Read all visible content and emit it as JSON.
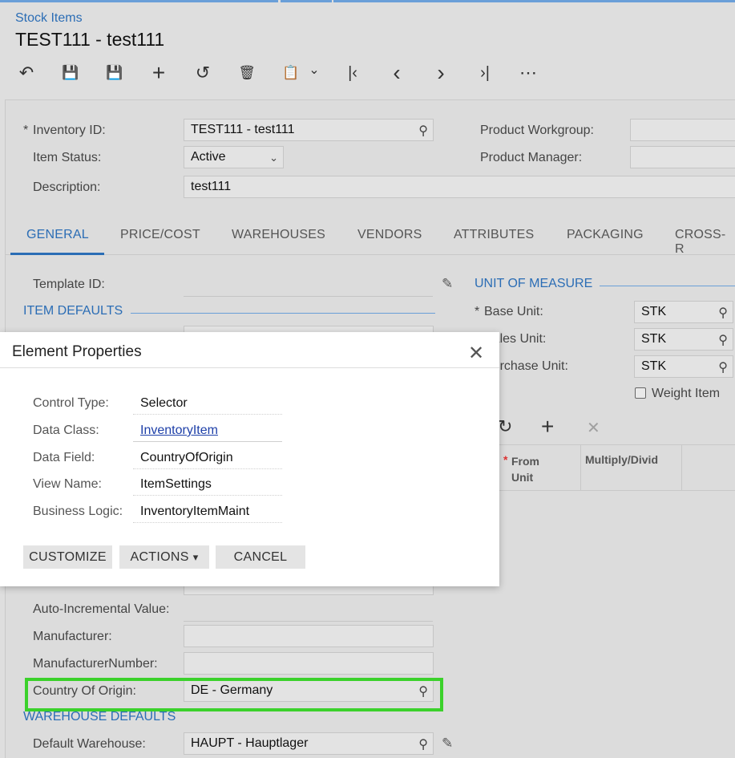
{
  "breadcrumb": "Stock Items",
  "page_title": "TEST111 - test111",
  "toolbar": {
    "back": "↶",
    "save_close": "💾",
    "save": "💾",
    "add": "+",
    "undo": "↺",
    "delete": "🗑",
    "clipboard": "📋",
    "clipboard_caret": "⌄",
    "first": "|‹",
    "prev": "‹",
    "next": "›",
    "last": "›|",
    "more": "⋯"
  },
  "summary": {
    "inventory_id_label": "Inventory ID:",
    "inventory_id_value": "TEST111 - test111",
    "item_status_label": "Item Status:",
    "item_status_value": "Active",
    "description_label": "Description:",
    "description_value": "test111",
    "product_workgroup_label": "Product Workgroup:",
    "product_manager_label": "Product Manager:"
  },
  "tabs": [
    "GENERAL",
    "PRICE/COST",
    "WAREHOUSES",
    "VENDORS",
    "ATTRIBUTES",
    "PACKAGING",
    "CROSS-R"
  ],
  "general": {
    "template_id_label": "Template ID:",
    "item_defaults_title": "ITEM DEFAULTS",
    "auto_incremental_label": "Auto-Incremental Value:",
    "manufacturer_label": "Manufacturer:",
    "manufacturer_number_label": "ManufacturerNumber:",
    "country_label": "Country Of Origin:",
    "country_value": "DE - Germany",
    "warehouse_defaults_title": "WAREHOUSE DEFAULTS",
    "default_warehouse_label": "Default Warehouse:",
    "default_warehouse_value": "HAUPT - Hauptlager"
  },
  "uom": {
    "title": "UNIT OF MEASURE",
    "base_unit_label": "Base Unit:",
    "base_unit_value": "STK",
    "sales_unit_label": "Sales Unit:",
    "sales_unit_value": "STK",
    "purchase_unit_label": "Purchase Unit:",
    "purchase_unit_value": "STK",
    "weight_item_label": "Weight Item",
    "grid_from_unit": "From Unit",
    "grid_multiply": "Multiply/Divid",
    "grid_tool_refresh": "↻",
    "grid_tool_add": "+",
    "grid_tool_delete": "✕"
  },
  "dialog": {
    "title": "Element Properties",
    "close": "✕",
    "props": [
      {
        "label": "Control Type:",
        "value": "Selector"
      },
      {
        "label": "Data Class:",
        "value": "InventoryItem"
      },
      {
        "label": "Data Field:",
        "value": "CountryOfOrigin"
      },
      {
        "label": "View Name:",
        "value": "ItemSettings"
      },
      {
        "label": "Business Logic:",
        "value": "InventoryItemMaint"
      }
    ],
    "btn_customize": "CUSTOMIZE",
    "btn_actions": "ACTIONS",
    "btn_actions_caret": "▾",
    "btn_cancel": "CANCEL"
  },
  "colors": {
    "accent": "#2b6db5",
    "highlight": "#3bd12b",
    "link": "#1d3fa8"
  }
}
